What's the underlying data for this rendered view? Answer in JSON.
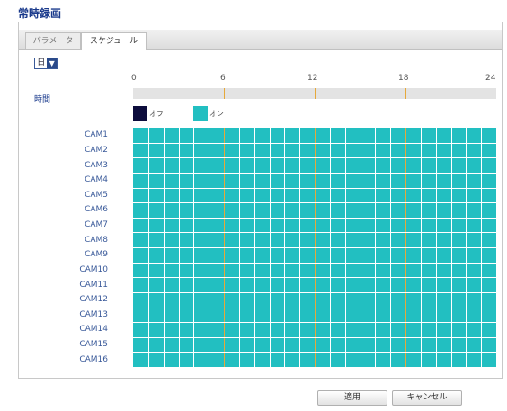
{
  "page": {
    "title": "常時録画"
  },
  "tabs": [
    {
      "label": "パラメータ",
      "active": false
    },
    {
      "label": "スケジュール",
      "active": true
    }
  ],
  "day_select": {
    "value": "日",
    "arrow_icon": "chevron-down-icon"
  },
  "time": {
    "label": "時間",
    "ticks": [
      "0",
      "6",
      "12",
      "18",
      "24"
    ]
  },
  "legend": {
    "off": {
      "label": "オフ",
      "color": "#0c0c3c"
    },
    "on": {
      "label": "オン",
      "color": "#22bfc1"
    }
  },
  "schedule": {
    "cameras": [
      "CAM1",
      "CAM2",
      "CAM3",
      "CAM4",
      "CAM5",
      "CAM6",
      "CAM7",
      "CAM8",
      "CAM9",
      "CAM10",
      "CAM11",
      "CAM12",
      "CAM13",
      "CAM14",
      "CAM15",
      "CAM16"
    ],
    "hours": 24,
    "all_on": true
  },
  "buttons": {
    "apply": "適用",
    "cancel": "キャンセル"
  },
  "colors": {
    "accent": "#1a3a8c",
    "grid_on": "#22bfc1",
    "marker": "#e6a83a"
  }
}
